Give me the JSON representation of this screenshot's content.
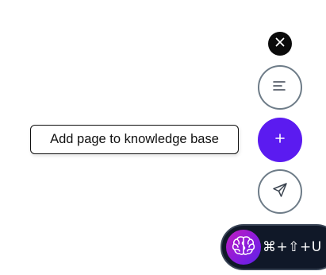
{
  "tooltip": {
    "text": "Add page to knowledge base"
  },
  "buttons": {
    "close": {
      "icon": "close-icon"
    },
    "list": {
      "icon": "list-lines-icon"
    },
    "add": {
      "icon": "plus-icon",
      "color": "#5b1bf0"
    },
    "send": {
      "icon": "send-icon"
    }
  },
  "shortcut": {
    "icon": "brain-icon",
    "keys": "⌘+⇧+U",
    "background": "#101828",
    "badge_gradient": [
      "#c01ec0",
      "#5b22e8"
    ]
  }
}
